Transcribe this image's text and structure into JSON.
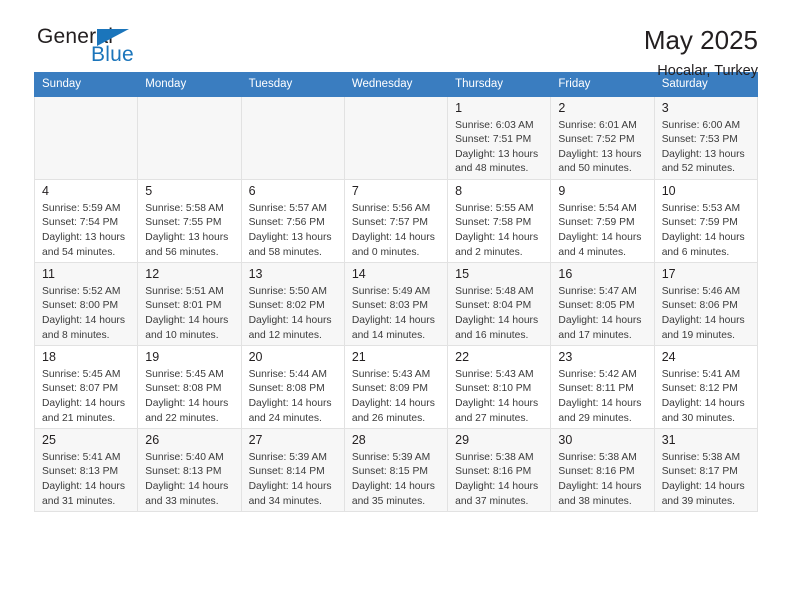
{
  "brand": {
    "word_one": "General",
    "word_two": "Blue",
    "accent_color": "#1b75bb",
    "triangle_icon": "triangle-icon"
  },
  "header": {
    "title": "May 2025",
    "subtitle": "Hocalar, Turkey"
  },
  "calendar": {
    "header_bg": "#3a7dc0",
    "weekday_headers": [
      "Sunday",
      "Monday",
      "Tuesday",
      "Wednesday",
      "Thursday",
      "Friday",
      "Saturday"
    ],
    "weeks": [
      [
        {
          "day": "",
          "sunrise": "",
          "sunset": "",
          "daylight_line1": "",
          "daylight_line2": ""
        },
        {
          "day": "",
          "sunrise": "",
          "sunset": "",
          "daylight_line1": "",
          "daylight_line2": ""
        },
        {
          "day": "",
          "sunrise": "",
          "sunset": "",
          "daylight_line1": "",
          "daylight_line2": ""
        },
        {
          "day": "",
          "sunrise": "",
          "sunset": "",
          "daylight_line1": "",
          "daylight_line2": ""
        },
        {
          "day": "1",
          "sunrise": "Sunrise: 6:03 AM",
          "sunset": "Sunset: 7:51 PM",
          "daylight_line1": "Daylight: 13 hours",
          "daylight_line2": "and 48 minutes."
        },
        {
          "day": "2",
          "sunrise": "Sunrise: 6:01 AM",
          "sunset": "Sunset: 7:52 PM",
          "daylight_line1": "Daylight: 13 hours",
          "daylight_line2": "and 50 minutes."
        },
        {
          "day": "3",
          "sunrise": "Sunrise: 6:00 AM",
          "sunset": "Sunset: 7:53 PM",
          "daylight_line1": "Daylight: 13 hours",
          "daylight_line2": "and 52 minutes."
        }
      ],
      [
        {
          "day": "4",
          "sunrise": "Sunrise: 5:59 AM",
          "sunset": "Sunset: 7:54 PM",
          "daylight_line1": "Daylight: 13 hours",
          "daylight_line2": "and 54 minutes."
        },
        {
          "day": "5",
          "sunrise": "Sunrise: 5:58 AM",
          "sunset": "Sunset: 7:55 PM",
          "daylight_line1": "Daylight: 13 hours",
          "daylight_line2": "and 56 minutes."
        },
        {
          "day": "6",
          "sunrise": "Sunrise: 5:57 AM",
          "sunset": "Sunset: 7:56 PM",
          "daylight_line1": "Daylight: 13 hours",
          "daylight_line2": "and 58 minutes."
        },
        {
          "day": "7",
          "sunrise": "Sunrise: 5:56 AM",
          "sunset": "Sunset: 7:57 PM",
          "daylight_line1": "Daylight: 14 hours",
          "daylight_line2": "and 0 minutes."
        },
        {
          "day": "8",
          "sunrise": "Sunrise: 5:55 AM",
          "sunset": "Sunset: 7:58 PM",
          "daylight_line1": "Daylight: 14 hours",
          "daylight_line2": "and 2 minutes."
        },
        {
          "day": "9",
          "sunrise": "Sunrise: 5:54 AM",
          "sunset": "Sunset: 7:59 PM",
          "daylight_line1": "Daylight: 14 hours",
          "daylight_line2": "and 4 minutes."
        },
        {
          "day": "10",
          "sunrise": "Sunrise: 5:53 AM",
          "sunset": "Sunset: 7:59 PM",
          "daylight_line1": "Daylight: 14 hours",
          "daylight_line2": "and 6 minutes."
        }
      ],
      [
        {
          "day": "11",
          "sunrise": "Sunrise: 5:52 AM",
          "sunset": "Sunset: 8:00 PM",
          "daylight_line1": "Daylight: 14 hours",
          "daylight_line2": "and 8 minutes."
        },
        {
          "day": "12",
          "sunrise": "Sunrise: 5:51 AM",
          "sunset": "Sunset: 8:01 PM",
          "daylight_line1": "Daylight: 14 hours",
          "daylight_line2": "and 10 minutes."
        },
        {
          "day": "13",
          "sunrise": "Sunrise: 5:50 AM",
          "sunset": "Sunset: 8:02 PM",
          "daylight_line1": "Daylight: 14 hours",
          "daylight_line2": "and 12 minutes."
        },
        {
          "day": "14",
          "sunrise": "Sunrise: 5:49 AM",
          "sunset": "Sunset: 8:03 PM",
          "daylight_line1": "Daylight: 14 hours",
          "daylight_line2": "and 14 minutes."
        },
        {
          "day": "15",
          "sunrise": "Sunrise: 5:48 AM",
          "sunset": "Sunset: 8:04 PM",
          "daylight_line1": "Daylight: 14 hours",
          "daylight_line2": "and 16 minutes."
        },
        {
          "day": "16",
          "sunrise": "Sunrise: 5:47 AM",
          "sunset": "Sunset: 8:05 PM",
          "daylight_line1": "Daylight: 14 hours",
          "daylight_line2": "and 17 minutes."
        },
        {
          "day": "17",
          "sunrise": "Sunrise: 5:46 AM",
          "sunset": "Sunset: 8:06 PM",
          "daylight_line1": "Daylight: 14 hours",
          "daylight_line2": "and 19 minutes."
        }
      ],
      [
        {
          "day": "18",
          "sunrise": "Sunrise: 5:45 AM",
          "sunset": "Sunset: 8:07 PM",
          "daylight_line1": "Daylight: 14 hours",
          "daylight_line2": "and 21 minutes."
        },
        {
          "day": "19",
          "sunrise": "Sunrise: 5:45 AM",
          "sunset": "Sunset: 8:08 PM",
          "daylight_line1": "Daylight: 14 hours",
          "daylight_line2": "and 22 minutes."
        },
        {
          "day": "20",
          "sunrise": "Sunrise: 5:44 AM",
          "sunset": "Sunset: 8:08 PM",
          "daylight_line1": "Daylight: 14 hours",
          "daylight_line2": "and 24 minutes."
        },
        {
          "day": "21",
          "sunrise": "Sunrise: 5:43 AM",
          "sunset": "Sunset: 8:09 PM",
          "daylight_line1": "Daylight: 14 hours",
          "daylight_line2": "and 26 minutes."
        },
        {
          "day": "22",
          "sunrise": "Sunrise: 5:43 AM",
          "sunset": "Sunset: 8:10 PM",
          "daylight_line1": "Daylight: 14 hours",
          "daylight_line2": "and 27 minutes."
        },
        {
          "day": "23",
          "sunrise": "Sunrise: 5:42 AM",
          "sunset": "Sunset: 8:11 PM",
          "daylight_line1": "Daylight: 14 hours",
          "daylight_line2": "and 29 minutes."
        },
        {
          "day": "24",
          "sunrise": "Sunrise: 5:41 AM",
          "sunset": "Sunset: 8:12 PM",
          "daylight_line1": "Daylight: 14 hours",
          "daylight_line2": "and 30 minutes."
        }
      ],
      [
        {
          "day": "25",
          "sunrise": "Sunrise: 5:41 AM",
          "sunset": "Sunset: 8:13 PM",
          "daylight_line1": "Daylight: 14 hours",
          "daylight_line2": "and 31 minutes."
        },
        {
          "day": "26",
          "sunrise": "Sunrise: 5:40 AM",
          "sunset": "Sunset: 8:13 PM",
          "daylight_line1": "Daylight: 14 hours",
          "daylight_line2": "and 33 minutes."
        },
        {
          "day": "27",
          "sunrise": "Sunrise: 5:39 AM",
          "sunset": "Sunset: 8:14 PM",
          "daylight_line1": "Daylight: 14 hours",
          "daylight_line2": "and 34 minutes."
        },
        {
          "day": "28",
          "sunrise": "Sunrise: 5:39 AM",
          "sunset": "Sunset: 8:15 PM",
          "daylight_line1": "Daylight: 14 hours",
          "daylight_line2": "and 35 minutes."
        },
        {
          "day": "29",
          "sunrise": "Sunrise: 5:38 AM",
          "sunset": "Sunset: 8:16 PM",
          "daylight_line1": "Daylight: 14 hours",
          "daylight_line2": "and 37 minutes."
        },
        {
          "day": "30",
          "sunrise": "Sunrise: 5:38 AM",
          "sunset": "Sunset: 8:16 PM",
          "daylight_line1": "Daylight: 14 hours",
          "daylight_line2": "and 38 minutes."
        },
        {
          "day": "31",
          "sunrise": "Sunrise: 5:38 AM",
          "sunset": "Sunset: 8:17 PM",
          "daylight_line1": "Daylight: 14 hours",
          "daylight_line2": "and 39 minutes."
        }
      ]
    ]
  }
}
